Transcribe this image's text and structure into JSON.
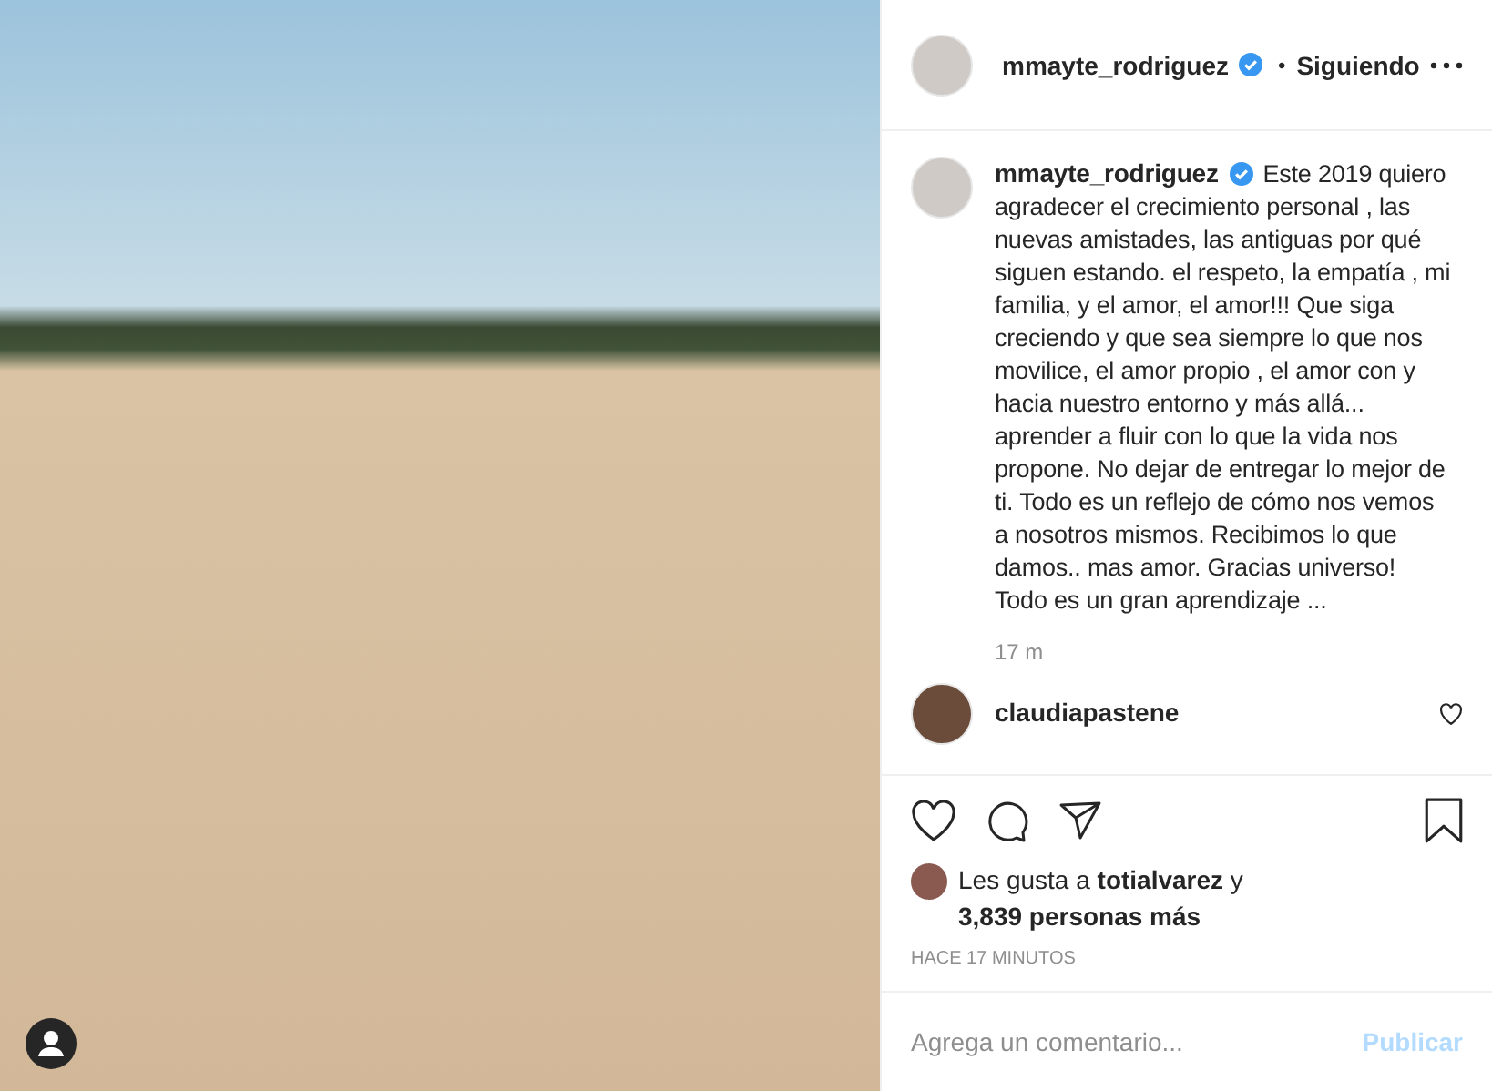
{
  "post": {
    "author": {
      "username": "mmayte_rodriguez",
      "verified": true,
      "separator": "•",
      "follow_status": "Siguiendo"
    },
    "caption_author": {
      "username": "mmayte_rodriguez",
      "verified": true
    },
    "caption": "Este 2019 quiero agradecer el crecimiento personal , las nuevas amistades, las antiguas por qué siguen estando. el respeto, la empatía , mi familia, y el amor, el amor!!! Que siga creciendo y que sea siempre lo que nos movilice, el amor propio , el amor con y hacia nuestro entorno y más allá... aprender a fluir con lo que la vida nos propone. No dejar de entregar lo mejor de ti. Todo es un reflejo de cómo nos vemos a nosotros mismos. Recibimos lo que damos.. mas amor. Gracias universo! Todo es un gran aprendizaje ...",
    "caption_age": "17 m",
    "comments": [
      {
        "username": "claudiapastene",
        "liked": false
      }
    ],
    "liked": false,
    "saved": false,
    "likes": {
      "prefix": "Les gusta a",
      "user": "totialvarez",
      "suffix": "y",
      "others": "3,839 personas más"
    },
    "timestamp": "HACE 17 MINUTOS",
    "comment_field": {
      "placeholder": "Agrega un comentario...",
      "button": "Publicar"
    }
  }
}
